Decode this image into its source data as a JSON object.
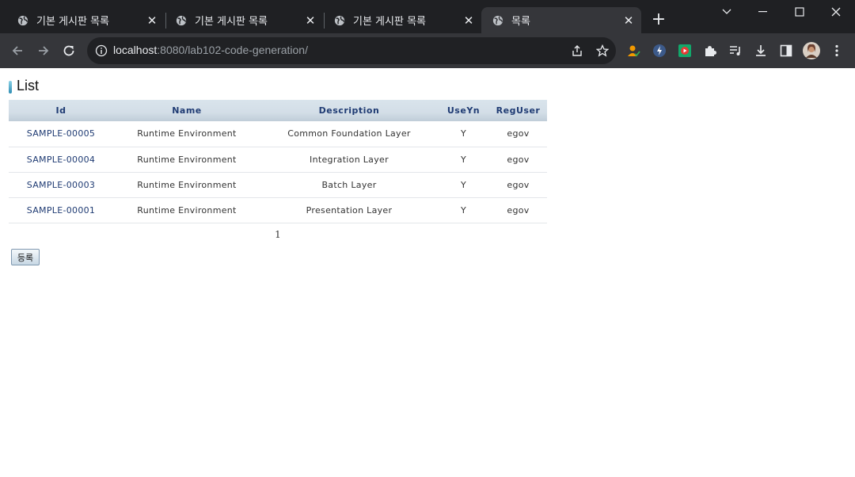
{
  "browser": {
    "tabs": [
      {
        "title": "기본 게시판 목록",
        "active": false
      },
      {
        "title": "기본 게시판 목록",
        "active": false
      },
      {
        "title": "기본 게시판 목록",
        "active": false
      },
      {
        "title": "목록",
        "active": true
      }
    ],
    "url_host": "localhost",
    "url_path": ":8080/lab102-code-generation/",
    "colors": {
      "tabstrip": "#1f2023",
      "toolbar": "#35363a",
      "omnibox": "#202124"
    }
  },
  "page": {
    "title": "List",
    "table": {
      "headers": [
        "Id",
        "Name",
        "Description",
        "UseYn",
        "RegUser"
      ],
      "rows": [
        {
          "id": "SAMPLE-00005",
          "name": "Runtime Environment",
          "description": "Common Foundation Layer",
          "use_yn": "Y",
          "reg_user": "egov"
        },
        {
          "id": "SAMPLE-00004",
          "name": "Runtime Environment",
          "description": "Integration Layer",
          "use_yn": "Y",
          "reg_user": "egov"
        },
        {
          "id": "SAMPLE-00003",
          "name": "Runtime Environment",
          "description": "Batch Layer",
          "use_yn": "Y",
          "reg_user": "egov"
        },
        {
          "id": "SAMPLE-00001",
          "name": "Runtime Environment",
          "description": "Presentation Layer",
          "use_yn": "Y",
          "reg_user": "egov"
        }
      ]
    },
    "pagination": {
      "current_page": "1"
    },
    "register_button": "등록"
  }
}
